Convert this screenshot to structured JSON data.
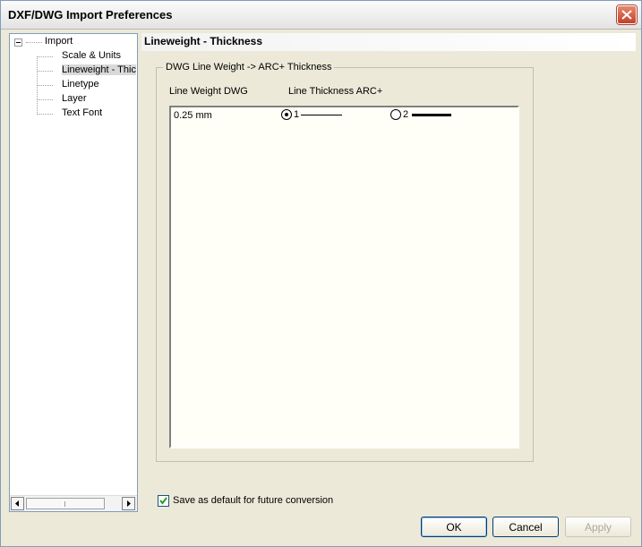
{
  "window": {
    "title": "DXF/DWG Import Preferences"
  },
  "tree": {
    "root": "Import",
    "items": [
      "Scale & Units",
      "Lineweight - Thickness",
      "Linetype",
      "Layer",
      "Text Font"
    ],
    "selected": "Lineweight - Thickness"
  },
  "panel": {
    "title": "Lineweight - Thickness"
  },
  "group": {
    "title": "DWG Line Weight -> ARC+ Thickness",
    "col_lineweight": "Line Weight DWG",
    "col_thickness": "Line Thickness ARC+",
    "rows": [
      {
        "weight": "0.25 mm",
        "option1_label": "1",
        "option2_label": "2",
        "selected": "1"
      }
    ]
  },
  "checkbox": {
    "label": "Save as default for future conversion",
    "checked": true
  },
  "buttons": {
    "ok": "OK",
    "cancel": "Cancel",
    "apply": "Apply"
  }
}
